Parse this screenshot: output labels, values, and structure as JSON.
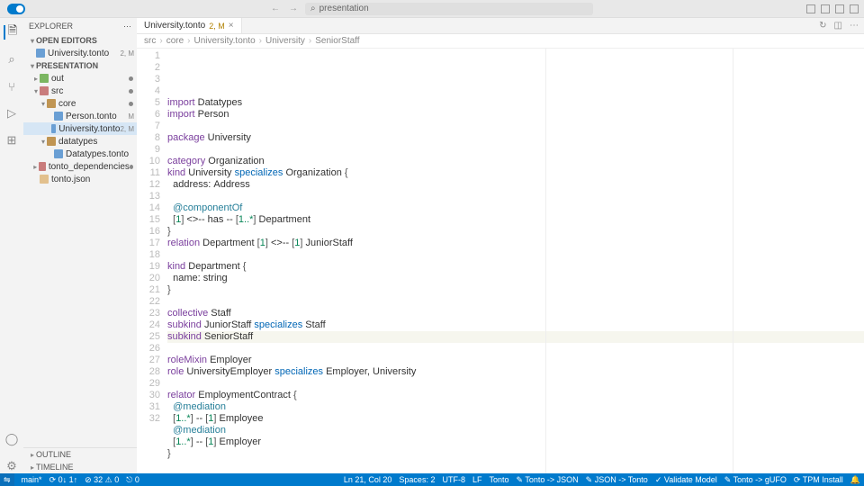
{
  "titlebar": {
    "search_placeholder": "presentation",
    "search_icon": "⌕"
  },
  "sidebar": {
    "title": "EXPLORER",
    "open_editors": "OPEN EDITORS",
    "project": "PRESENTATION",
    "outline": "OUTLINE",
    "timeline": "TIMELINE",
    "open_items": [
      {
        "name": "University.tonto",
        "badge": "2, M"
      }
    ],
    "tree": [
      {
        "name": "out",
        "type": "folder",
        "cls": "green",
        "indent": 1,
        "arrow": "▸",
        "badge": "●"
      },
      {
        "name": "src",
        "type": "folder",
        "cls": "red",
        "indent": 1,
        "arrow": "▾",
        "badge": "●"
      },
      {
        "name": "core",
        "type": "folder",
        "cls": "folder",
        "indent": 2,
        "arrow": "▾",
        "badge": "●"
      },
      {
        "name": "Person.tonto",
        "type": "file",
        "cls": "blue",
        "indent": 3,
        "badge": "M"
      },
      {
        "name": "University.tonto",
        "type": "file",
        "cls": "blue",
        "indent": 3,
        "badge": "2, M",
        "active": true
      },
      {
        "name": "datatypes",
        "type": "folder",
        "cls": "folder",
        "indent": 2,
        "arrow": "▾"
      },
      {
        "name": "Datatypes.tonto",
        "type": "file",
        "cls": "blue",
        "indent": 3
      },
      {
        "name": "tonto_dependencies",
        "type": "folder",
        "cls": "red",
        "indent": 1,
        "arrow": "▸",
        "badge": "●"
      },
      {
        "name": "tonto.json",
        "type": "file",
        "cls": "json",
        "indent": 1
      }
    ]
  },
  "tabs": {
    "active": {
      "name": "University.tonto",
      "mod": "2, M"
    }
  },
  "breadcrumbs": [
    "src",
    "core",
    "University.tonto",
    "University",
    "SeniorStaff"
  ],
  "editor": {
    "current_line": 21,
    "lines": [
      [
        [
          "kw",
          "import"
        ],
        [
          "",
          " Datatypes"
        ]
      ],
      [
        [
          "kw",
          "import"
        ],
        [
          "",
          " Person"
        ]
      ],
      [],
      [
        [
          "kw",
          "package"
        ],
        [
          "",
          " University"
        ]
      ],
      [],
      [
        [
          "kw",
          "category"
        ],
        [
          "",
          " Organization"
        ]
      ],
      [
        [
          "kw",
          "kind"
        ],
        [
          "",
          " University "
        ],
        [
          "kw2",
          "specializes"
        ],
        [
          "",
          " Organization "
        ],
        [
          "sym",
          "{"
        ]
      ],
      [
        [
          "",
          "  address: Address"
        ]
      ],
      [],
      [
        [
          "",
          "  "
        ],
        [
          "id",
          "@componentOf"
        ]
      ],
      [
        [
          "",
          "  "
        ],
        [
          "sym",
          "["
        ],
        [
          "num",
          "1"
        ],
        [
          "sym",
          "]"
        ],
        [
          "",
          " <>-- has -- "
        ],
        [
          "sym",
          "["
        ],
        [
          "num",
          "1..*"
        ],
        [
          "sym",
          "]"
        ],
        [
          "",
          " Department"
        ]
      ],
      [
        [
          "sym",
          "}"
        ]
      ],
      [
        [
          "kw",
          "relation"
        ],
        [
          "",
          " Department "
        ],
        [
          "sym",
          "["
        ],
        [
          "num",
          "1"
        ],
        [
          "sym",
          "]"
        ],
        [
          "",
          " <>-- "
        ],
        [
          "sym",
          "["
        ],
        [
          "num",
          "1"
        ],
        [
          "sym",
          "]"
        ],
        [
          "",
          " JuniorStaff"
        ]
      ],
      [],
      [
        [
          "kw",
          "kind"
        ],
        [
          "",
          " Department "
        ],
        [
          "sym",
          "{"
        ]
      ],
      [
        [
          "",
          "  name: string"
        ]
      ],
      [
        [
          "sym",
          "}"
        ]
      ],
      [],
      [
        [
          "kw",
          "collective"
        ],
        [
          "",
          " Staff"
        ]
      ],
      [
        [
          "kw",
          "subkind"
        ],
        [
          "",
          " JuniorStaff "
        ],
        [
          "kw2",
          "specializes"
        ],
        [
          "",
          " Staff"
        ]
      ],
      [
        [
          "kw",
          "subkind"
        ],
        [
          "",
          " SeniorStaff"
        ]
      ],
      [],
      [
        [
          "kw",
          "roleMixin"
        ],
        [
          "",
          " Employer"
        ]
      ],
      [
        [
          "kw",
          "role"
        ],
        [
          "",
          " UniversityEmployer "
        ],
        [
          "kw2",
          "specializes"
        ],
        [
          "",
          " Employer, University"
        ]
      ],
      [],
      [
        [
          "kw",
          "relator"
        ],
        [
          "",
          " EmploymentContract "
        ],
        [
          "sym",
          "{"
        ]
      ],
      [
        [
          "",
          "  "
        ],
        [
          "id",
          "@mediation"
        ]
      ],
      [
        [
          "",
          "  "
        ],
        [
          "sym",
          "["
        ],
        [
          "num",
          "1..*"
        ],
        [
          "sym",
          "]"
        ],
        [
          "",
          " -- "
        ],
        [
          "sym",
          "["
        ],
        [
          "num",
          "1"
        ],
        [
          "sym",
          "]"
        ],
        [
          "",
          " Employee"
        ]
      ],
      [
        [
          "",
          "  "
        ],
        [
          "id",
          "@mediation"
        ]
      ],
      [
        [
          "",
          "  "
        ],
        [
          "sym",
          "["
        ],
        [
          "num",
          "1..*"
        ],
        [
          "sym",
          "]"
        ],
        [
          "",
          " -- "
        ],
        [
          "sym",
          "["
        ],
        [
          "num",
          "1"
        ],
        [
          "sym",
          "]"
        ],
        [
          "",
          " Employer"
        ]
      ],
      [
        [
          "sym",
          "}"
        ]
      ],
      []
    ]
  },
  "statusbar": {
    "left": [
      "main*",
      "⟳ 0↓ 1↑",
      "⊘ 32 ⚠ 0",
      "⎋ 0"
    ],
    "right": [
      "Ln 21, Col 20",
      "Spaces: 2",
      "UTF-8",
      "LF",
      "Tonto",
      "✎ Tonto -> JSON",
      "✎ JSON -> Tonto",
      "✓ Validate Model",
      "✎ Tonto -> gUFO",
      "⟳ TPM Install",
      "🔔"
    ]
  }
}
